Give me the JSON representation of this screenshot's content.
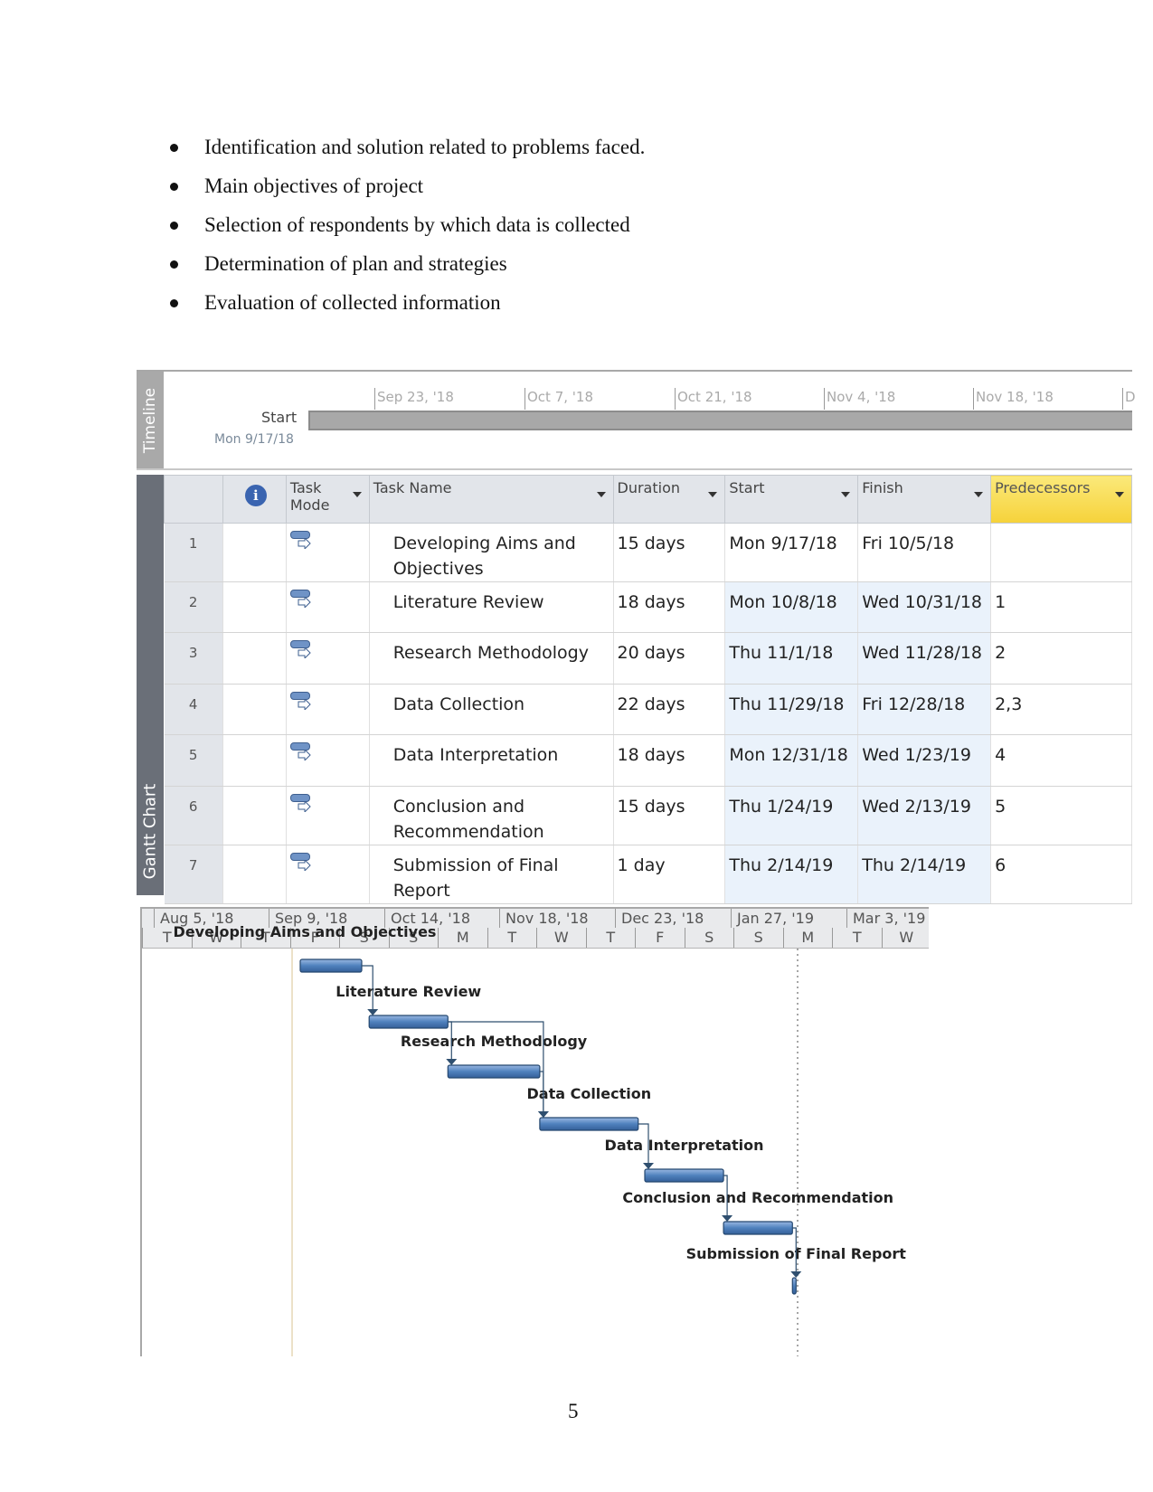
{
  "bullets": [
    "Identification and solution related to problems faced.",
    "Main objectives of project",
    "Selection of respondents by which data is collected",
    "Determination of plan and strategies",
    "Evaluation of collected information"
  ],
  "timeline": {
    "tab_label": "Timeline",
    "start_label": "Start",
    "start_date": "Mon 9/17/18",
    "ticks": [
      "Sep 23, '18",
      "Oct 7, '18",
      "Oct 21, '18",
      "Nov 4, '18",
      "Nov 18, '18",
      "D"
    ]
  },
  "grid": {
    "tab_label": "Gantt Chart",
    "columns": {
      "info": "info-icon",
      "task_mode": "Task Mode",
      "task_name": "Task Name",
      "duration": "Duration",
      "start": "Start",
      "finish": "Finish",
      "predecessors": "Predecessors"
    },
    "rows": [
      {
        "id": "1",
        "name": "Developing Aims and Objectives",
        "duration": "15 days",
        "start": "Mon 9/17/18",
        "finish": "Fri 10/5/18",
        "pred": ""
      },
      {
        "id": "2",
        "name": "Literature Review",
        "duration": "18 days",
        "start": "Mon 10/8/18",
        "finish": "Wed 10/31/18",
        "pred": "1"
      },
      {
        "id": "3",
        "name": "Research Methodology",
        "duration": "20 days",
        "start": "Thu 11/1/18",
        "finish": "Wed 11/28/18",
        "pred": "2"
      },
      {
        "id": "4",
        "name": "Data Collection",
        "duration": "22 days",
        "start": "Thu 11/29/18",
        "finish": "Fri 12/28/18",
        "pred": "2,3"
      },
      {
        "id": "5",
        "name": "Data Interpretation",
        "duration": "18 days",
        "start": "Mon 12/31/18",
        "finish": "Wed 1/23/19",
        "pred": "4"
      },
      {
        "id": "6",
        "name": "Conclusion and Recommendation",
        "duration": "15 days",
        "start": "Thu 1/24/19",
        "finish": "Wed 2/13/19",
        "pred": "5"
      },
      {
        "id": "7",
        "name": "Submission of Final Report",
        "duration": "1 day",
        "start": "Thu 2/14/19",
        "finish": "Thu 2/14/19",
        "pred": "6"
      }
    ]
  },
  "gantt": {
    "major_ticks": [
      "Aug 5, '18",
      "Sep 9, '18",
      "Oct 14, '18",
      "Nov 18, '18",
      "Dec 23, '18",
      "Jan 27, '19",
      "Mar 3, '19"
    ],
    "minor_ticks": [
      "T",
      "W",
      "T",
      "F",
      "S",
      "S",
      "M",
      "T",
      "W",
      "T",
      "F",
      "S",
      "S",
      "M",
      "T",
      "W"
    ],
    "tasks": [
      "Developing Aims and Objectives",
      "Literature Review",
      "Research Methodology",
      "Data Collection",
      "Data Interpretation",
      "Conclusion and Recommendation",
      "Submission of Final Report"
    ],
    "bar_color": "#4f81bd"
  },
  "page_number": "5"
}
